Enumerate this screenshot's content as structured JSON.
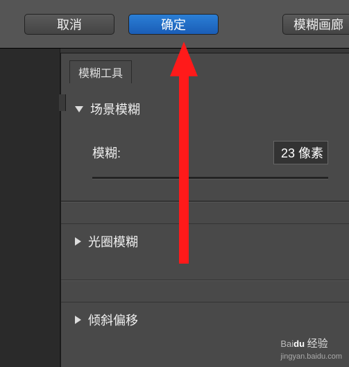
{
  "toolbar": {
    "cancel_label": "取消",
    "ok_label": "确定",
    "gallery_label": "模糊画廊"
  },
  "panel": {
    "tab_title": "模糊工具",
    "sections": {
      "field_blur": {
        "title": "场景模糊",
        "slider_label": "模糊:",
        "slider_value": "23 像素"
      },
      "iris_blur": {
        "title": "光圈模糊"
      },
      "tilt_shift": {
        "title": "倾斜偏移"
      }
    }
  },
  "watermark": {
    "brand_html": "Baidu",
    "jingyan": "经验",
    "url": "jingyan.baidu.com"
  },
  "annotation": {
    "arrow_color": "#ff0000"
  }
}
